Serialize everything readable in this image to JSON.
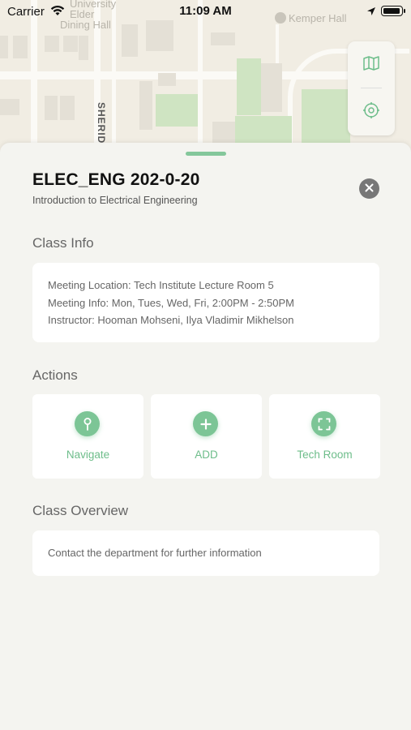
{
  "status_bar": {
    "carrier": "Carrier",
    "time": "11:09 AM"
  },
  "map": {
    "labels": {
      "university": "University",
      "elder": "Elder",
      "dining_hall": "Dining Hall",
      "kemper_hall": "Kemper Hall",
      "street": "SHERID"
    },
    "controls": [
      "map-icon",
      "settings-icon"
    ]
  },
  "course": {
    "code": "ELEC_ENG 202-0-20",
    "name": "Introduction to Electrical Engineering"
  },
  "class_info": {
    "title": "Class Info",
    "meeting_location": "Meeting Location: Tech Institute Lecture Room 5",
    "meeting_info": "Meeting Info: Mon, Tues, Wed, Fri,  2:00PM - 2:50PM",
    "instructor": "Instructor: Hooman Mohseni,  Ilya Vladimir Mikhelson"
  },
  "actions": {
    "title": "Actions",
    "items": [
      {
        "label": "Navigate",
        "icon": "pin-icon"
      },
      {
        "label": "ADD",
        "icon": "plus-icon"
      },
      {
        "label": "Tech Room",
        "icon": "expand-icon"
      }
    ]
  },
  "overview": {
    "title": "Class Overview",
    "text": "Contact the department for further information"
  },
  "colors": {
    "accent": "#7cc596",
    "accent_text": "#6dbd8a",
    "background": "#f4f4f0",
    "close_button": "#777777"
  }
}
